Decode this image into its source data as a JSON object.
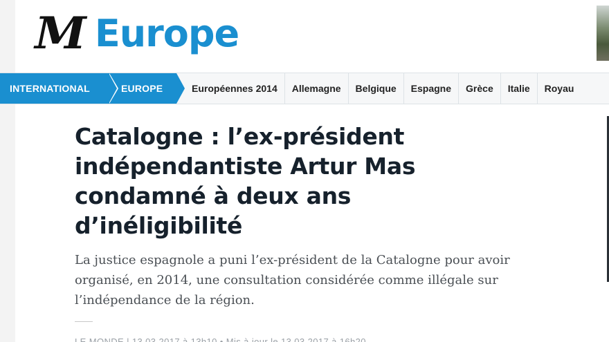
{
  "header": {
    "logo": "M",
    "section_title": "Europe"
  },
  "nav": {
    "breadcrumb": [
      "INTERNATIONAL",
      "EUROPE"
    ],
    "links": [
      "Européennes 2014",
      "Allemagne",
      "Belgique",
      "Espagne",
      "Grèce",
      "Italie",
      "Royau"
    ]
  },
  "article": {
    "headline": "Catalogne : l’ex-président indépendantiste Artur Mas condamné à deux ans d’inéligibilité",
    "lede": "La justice espagnole a puni l’ex-président de la Catalogne pour avoir organisé, en 2014, une consultation considérée comme illégale sur l’indépendance de la région.",
    "byline": "LE MONDE | 13.03.2017 à 13h10 • Mis à jour le 13.03.2017 à 16h20"
  },
  "colors": {
    "accent": "#1a8fd0",
    "headline": "#16212c",
    "lede": "#4a4f54",
    "nav_bg": "#f6f7f8"
  }
}
